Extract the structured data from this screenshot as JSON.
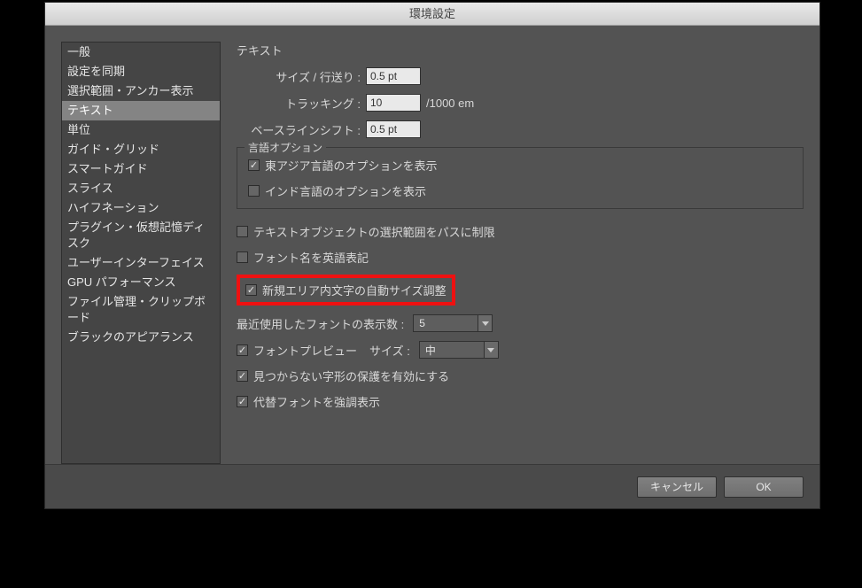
{
  "title": "環境設定",
  "sidebar": {
    "items": [
      {
        "label": "一般"
      },
      {
        "label": "設定を同期"
      },
      {
        "label": "選択範囲・アンカー表示"
      },
      {
        "label": "テキスト"
      },
      {
        "label": "単位"
      },
      {
        "label": "ガイド・グリッド"
      },
      {
        "label": "スマートガイド"
      },
      {
        "label": "スライス"
      },
      {
        "label": "ハイフネーション"
      },
      {
        "label": "プラグイン・仮想記憶ディスク"
      },
      {
        "label": "ユーザーインターフェイス"
      },
      {
        "label": "GPU パフォーマンス"
      },
      {
        "label": "ファイル管理・クリップボード"
      },
      {
        "label": "ブラックのアピアランス"
      }
    ],
    "selected_index": 3
  },
  "main": {
    "section": "テキスト",
    "size_leading": {
      "label": "サイズ / 行送り :",
      "value": "0.5 pt"
    },
    "tracking": {
      "label": "トラッキング :",
      "value": "10",
      "suffix": "/1000 em"
    },
    "baseline": {
      "label": "ベースラインシフト :",
      "value": "0.5 pt"
    },
    "lang_group": {
      "title": "言語オプション",
      "east_asian": {
        "checked": true,
        "label": "東アジア言語のオプションを表示"
      },
      "indic": {
        "checked": false,
        "label": "インド言語のオプションを表示"
      }
    },
    "restrict_path": {
      "checked": false,
      "label": "テキストオブジェクトの選択範囲をパスに制限"
    },
    "english_font": {
      "checked": false,
      "label": "フォント名を英語表記"
    },
    "auto_size": {
      "checked": true,
      "label": "新規エリア内文字の自動サイズ調整"
    },
    "recent_fonts": {
      "label": "最近使用したフォントの表示数 :",
      "value": "5"
    },
    "font_preview": {
      "checked": true,
      "label": "フォントプレビュー",
      "size_label": "サイズ :",
      "value": "中"
    },
    "missing_glyph": {
      "checked": true,
      "label": "見つからない字形の保護を有効にする"
    },
    "highlight_sub": {
      "checked": true,
      "label": "代替フォントを強調表示"
    }
  },
  "footer": {
    "cancel": "キャンセル",
    "ok": "OK"
  }
}
